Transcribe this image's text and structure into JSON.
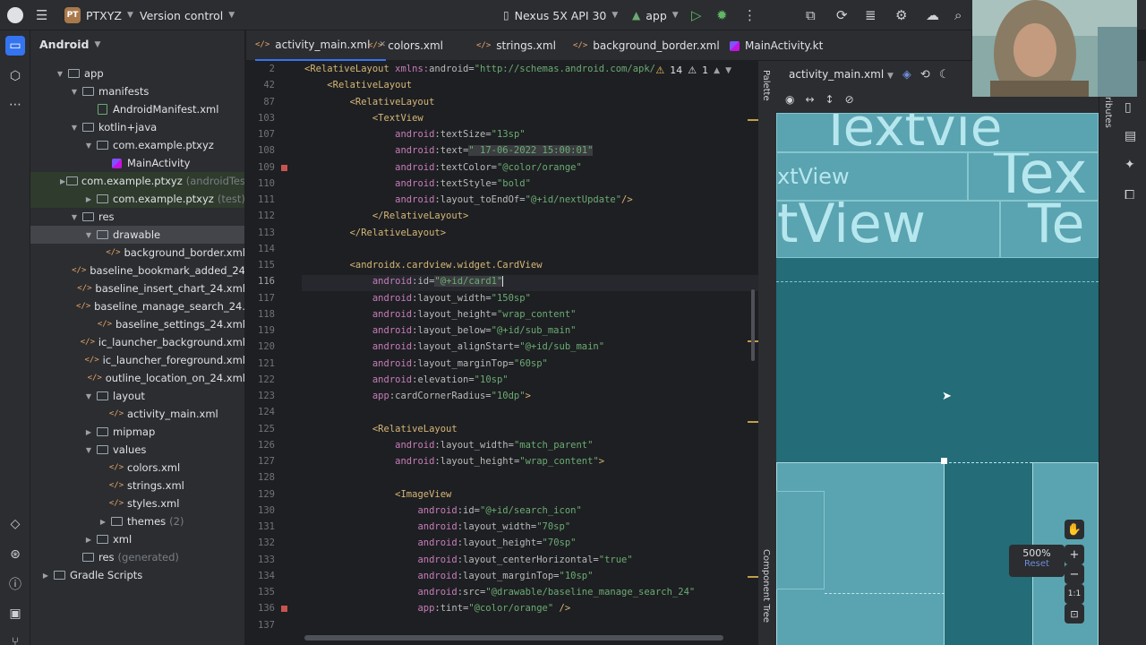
{
  "toolbar": {
    "project_badge": "PT",
    "project_name": "PTXYZ",
    "version_control": "Version control",
    "device": "Nexus 5X API 30",
    "run_config": "app"
  },
  "project_panel": {
    "title": "Android",
    "tree": [
      {
        "label": "app",
        "indent": 1,
        "expanded": true,
        "icon": "folder"
      },
      {
        "label": "manifests",
        "indent": 2,
        "expanded": true,
        "icon": "folder"
      },
      {
        "label": "AndroidManifest.xml",
        "indent": 3,
        "icon": "manifest"
      },
      {
        "label": "kotlin+java",
        "indent": 2,
        "expanded": true,
        "icon": "folder"
      },
      {
        "label": "com.example.ptxyz",
        "indent": 3,
        "expanded": true,
        "icon": "folder"
      },
      {
        "label": "MainActivity",
        "indent": 4,
        "icon": "kotlin"
      },
      {
        "label": "com.example.ptxyz",
        "suffix": "(androidTes",
        "indent": 3,
        "expanded": false,
        "icon": "folder",
        "green": true
      },
      {
        "label": "com.example.ptxyz",
        "suffix": "(test)",
        "indent": 3,
        "expanded": false,
        "icon": "folder",
        "green": true
      },
      {
        "label": "res",
        "indent": 2,
        "expanded": true,
        "icon": "folder"
      },
      {
        "label": "drawable",
        "indent": 3,
        "expanded": true,
        "icon": "folder",
        "selected": true
      },
      {
        "label": "background_border.xml",
        "indent": 4,
        "icon": "xml"
      },
      {
        "label": "baseline_bookmark_added_24",
        "indent": 4,
        "icon": "xml"
      },
      {
        "label": "baseline_insert_chart_24.xml",
        "indent": 4,
        "icon": "xml"
      },
      {
        "label": "baseline_manage_search_24.",
        "indent": 4,
        "icon": "xml"
      },
      {
        "label": "baseline_settings_24.xml",
        "indent": 4,
        "icon": "xml"
      },
      {
        "label": "ic_launcher_background.xml",
        "indent": 4,
        "icon": "xml"
      },
      {
        "label": "ic_launcher_foreground.xml",
        "indent": 4,
        "icon": "xml"
      },
      {
        "label": "outline_location_on_24.xml",
        "indent": 4,
        "icon": "xml"
      },
      {
        "label": "layout",
        "indent": 3,
        "expanded": true,
        "icon": "folder"
      },
      {
        "label": "activity_main.xml",
        "indent": 4,
        "icon": "xml"
      },
      {
        "label": "mipmap",
        "indent": 3,
        "expanded": false,
        "icon": "folder"
      },
      {
        "label": "values",
        "indent": 3,
        "expanded": true,
        "icon": "folder"
      },
      {
        "label": "colors.xml",
        "indent": 4,
        "icon": "xml"
      },
      {
        "label": "strings.xml",
        "indent": 4,
        "icon": "xml"
      },
      {
        "label": "styles.xml",
        "indent": 4,
        "icon": "xml"
      },
      {
        "label": "themes",
        "suffix": "(2)",
        "indent": 4,
        "expanded": false,
        "icon": "folder"
      },
      {
        "label": "xml",
        "indent": 3,
        "expanded": false,
        "icon": "folder"
      },
      {
        "label": "res",
        "suffix": "(generated)",
        "indent": 2,
        "icon": "folder"
      },
      {
        "label": "Gradle Scripts",
        "indent": 0,
        "expanded": false,
        "icon": "gradle"
      }
    ]
  },
  "tabs": [
    {
      "label": "activity_main.xml",
      "active": true,
      "closable": true
    },
    {
      "label": "colors.xml"
    },
    {
      "label": "strings.xml"
    },
    {
      "label": "background_border.xml"
    },
    {
      "label": "MainActivity.kt",
      "kotlin": true
    }
  ],
  "editor": {
    "warnings": "14",
    "weak_warnings": "1",
    "lines": [
      {
        "n": "2",
        "tokens": [
          [
            "tag",
            "<RelativeLayout "
          ],
          [
            "ns",
            "xmlns:"
          ],
          [
            "attr",
            "android"
          ],
          [
            "punc",
            "="
          ],
          [
            "str",
            "\"http://schemas.android.com/apk/"
          ]
        ]
      },
      {
        "n": "42",
        "tokens": [
          [
            "pad",
            "    "
          ],
          [
            "tag",
            "<RelativeLayout"
          ]
        ]
      },
      {
        "n": "87",
        "tokens": [
          [
            "pad",
            "        "
          ],
          [
            "tag",
            "<RelativeLayout"
          ]
        ]
      },
      {
        "n": "103",
        "tokens": [
          [
            "pad",
            "            "
          ],
          [
            "tag",
            "<TextView"
          ]
        ]
      },
      {
        "n": "107",
        "tokens": [
          [
            "pad",
            "                "
          ],
          [
            "ns",
            "android"
          ],
          [
            "attr",
            ":textSize"
          ],
          [
            "punc",
            "="
          ],
          [
            "str",
            "\"13sp\""
          ]
        ]
      },
      {
        "n": "108",
        "tokens": [
          [
            "pad",
            "                "
          ],
          [
            "ns",
            "android"
          ],
          [
            "attr",
            ":text"
          ],
          [
            "punc",
            "="
          ],
          [
            "strbg",
            "\" 17-06-2022 15:00:01\""
          ]
        ]
      },
      {
        "n": "109",
        "bp": true,
        "tokens": [
          [
            "pad",
            "                "
          ],
          [
            "ns",
            "android"
          ],
          [
            "attr",
            ":textColor"
          ],
          [
            "punc",
            "="
          ],
          [
            "str",
            "\"@color/orange\""
          ]
        ]
      },
      {
        "n": "110",
        "tokens": [
          [
            "pad",
            "                "
          ],
          [
            "ns",
            "android"
          ],
          [
            "attr",
            ":textStyle"
          ],
          [
            "punc",
            "="
          ],
          [
            "str",
            "\"bold\""
          ]
        ]
      },
      {
        "n": "111",
        "tokens": [
          [
            "pad",
            "                "
          ],
          [
            "ns",
            "android"
          ],
          [
            "attr",
            ":layout_toEndOf"
          ],
          [
            "punc",
            "="
          ],
          [
            "str",
            "\"@+id/nextUpdate\""
          ],
          [
            "tag",
            "/>"
          ]
        ]
      },
      {
        "n": "112",
        "tokens": [
          [
            "pad",
            "            "
          ],
          [
            "tag",
            "</RelativeLayout>"
          ]
        ]
      },
      {
        "n": "113",
        "tokens": [
          [
            "pad",
            "        "
          ],
          [
            "tag",
            "</RelativeLayout>"
          ]
        ]
      },
      {
        "n": "114",
        "tokens": []
      },
      {
        "n": "115",
        "tokens": [
          [
            "pad",
            "        "
          ],
          [
            "tag",
            "<androidx.cardview.widget.CardView"
          ]
        ]
      },
      {
        "n": "116",
        "current": true,
        "tokens": [
          [
            "pad",
            "            "
          ],
          [
            "ns",
            "android"
          ],
          [
            "attr",
            ":id"
          ],
          [
            "punc",
            "="
          ],
          [
            "strbg",
            "\"@+id/card1\""
          ]
        ]
      },
      {
        "n": "117",
        "tokens": [
          [
            "pad",
            "            "
          ],
          [
            "ns",
            "android"
          ],
          [
            "attr",
            ":layout_width"
          ],
          [
            "punc",
            "="
          ],
          [
            "str",
            "\"150sp\""
          ]
        ]
      },
      {
        "n": "118",
        "tokens": [
          [
            "pad",
            "            "
          ],
          [
            "ns",
            "android"
          ],
          [
            "attr",
            ":layout_height"
          ],
          [
            "punc",
            "="
          ],
          [
            "str",
            "\"wrap_content\""
          ]
        ]
      },
      {
        "n": "119",
        "tokens": [
          [
            "pad",
            "            "
          ],
          [
            "ns",
            "android"
          ],
          [
            "attr",
            ":layout_below"
          ],
          [
            "punc",
            "="
          ],
          [
            "str",
            "\"@+id/sub_main\""
          ]
        ]
      },
      {
        "n": "120",
        "tokens": [
          [
            "pad",
            "            "
          ],
          [
            "ns",
            "android"
          ],
          [
            "attr",
            ":layout_alignStart"
          ],
          [
            "punc",
            "="
          ],
          [
            "str",
            "\"@+id/sub_main\""
          ]
        ]
      },
      {
        "n": "121",
        "tokens": [
          [
            "pad",
            "            "
          ],
          [
            "ns",
            "android"
          ],
          [
            "attr",
            ":layout_marginTop"
          ],
          [
            "punc",
            "="
          ],
          [
            "str",
            "\"60sp\""
          ]
        ]
      },
      {
        "n": "122",
        "tokens": [
          [
            "pad",
            "            "
          ],
          [
            "ns",
            "android"
          ],
          [
            "attr",
            ":elevation"
          ],
          [
            "punc",
            "="
          ],
          [
            "str",
            "\"10sp\""
          ]
        ]
      },
      {
        "n": "123",
        "tokens": [
          [
            "pad",
            "            "
          ],
          [
            "ns",
            "app"
          ],
          [
            "attr",
            ":cardCornerRadius"
          ],
          [
            "punc",
            "="
          ],
          [
            "str",
            "\"10dp\""
          ],
          [
            "tag",
            ">"
          ]
        ]
      },
      {
        "n": "124",
        "tokens": []
      },
      {
        "n": "125",
        "tokens": [
          [
            "pad",
            "            "
          ],
          [
            "tag",
            "<RelativeLayout"
          ]
        ]
      },
      {
        "n": "126",
        "tokens": [
          [
            "pad",
            "                "
          ],
          [
            "ns",
            "android"
          ],
          [
            "attr",
            ":layout_width"
          ],
          [
            "punc",
            "="
          ],
          [
            "str",
            "\"match_parent\""
          ]
        ]
      },
      {
        "n": "127",
        "tokens": [
          [
            "pad",
            "                "
          ],
          [
            "ns",
            "android"
          ],
          [
            "attr",
            ":layout_height"
          ],
          [
            "punc",
            "="
          ],
          [
            "str",
            "\"wrap_content\""
          ],
          [
            "tag",
            ">"
          ]
        ]
      },
      {
        "n": "128",
        "tokens": []
      },
      {
        "n": "129",
        "tokens": [
          [
            "pad",
            "                "
          ],
          [
            "tag",
            "<ImageView"
          ]
        ]
      },
      {
        "n": "130",
        "tokens": [
          [
            "pad",
            "                    "
          ],
          [
            "ns",
            "android"
          ],
          [
            "attr",
            ":id"
          ],
          [
            "punc",
            "="
          ],
          [
            "str",
            "\"@+id/search_icon\""
          ]
        ]
      },
      {
        "n": "131",
        "tokens": [
          [
            "pad",
            "                    "
          ],
          [
            "ns",
            "android"
          ],
          [
            "attr",
            ":layout_width"
          ],
          [
            "punc",
            "="
          ],
          [
            "str",
            "\"70sp\""
          ]
        ]
      },
      {
        "n": "132",
        "tokens": [
          [
            "pad",
            "                    "
          ],
          [
            "ns",
            "android"
          ],
          [
            "attr",
            ":layout_height"
          ],
          [
            "punc",
            "="
          ],
          [
            "str",
            "\"70sp\""
          ]
        ]
      },
      {
        "n": "133",
        "tokens": [
          [
            "pad",
            "                    "
          ],
          [
            "ns",
            "android"
          ],
          [
            "attr",
            ":layout_centerHorizontal"
          ],
          [
            "punc",
            "="
          ],
          [
            "str",
            "\"true\""
          ]
        ]
      },
      {
        "n": "134",
        "tokens": [
          [
            "pad",
            "                    "
          ],
          [
            "ns",
            "android"
          ],
          [
            "attr",
            ":layout_marginTop"
          ],
          [
            "punc",
            "="
          ],
          [
            "str",
            "\"10sp\""
          ]
        ]
      },
      {
        "n": "135",
        "tokens": [
          [
            "pad",
            "                    "
          ],
          [
            "ns",
            "android"
          ],
          [
            "attr",
            ":src"
          ],
          [
            "punc",
            "="
          ],
          [
            "str",
            "\"@drawable/baseline_manage_search_24\""
          ]
        ]
      },
      {
        "n": "136",
        "bp": true,
        "tokens": [
          [
            "pad",
            "                    "
          ],
          [
            "ns",
            "app"
          ],
          [
            "attr",
            ":tint"
          ],
          [
            "punc",
            "="
          ],
          [
            "str",
            "\"@color/orange\""
          ],
          [
            "tag",
            " />"
          ]
        ]
      },
      {
        "n": "137",
        "tokens": []
      }
    ]
  },
  "design": {
    "file": "activity_main.xml",
    "preview_texts": [
      "Textvie",
      "xtView",
      "Tex",
      "tView",
      "Te"
    ],
    "zoom_level": "500%",
    "zoom_reset": "Reset",
    "zoom_fit": "1:1",
    "palette_label": "Palette",
    "component_tree_label": "Component Tree",
    "attributes_label": "ributes"
  },
  "colors": {
    "accent": "#3574f0",
    "canvas": "#236c78",
    "blueprint": "#5aa3b0"
  }
}
